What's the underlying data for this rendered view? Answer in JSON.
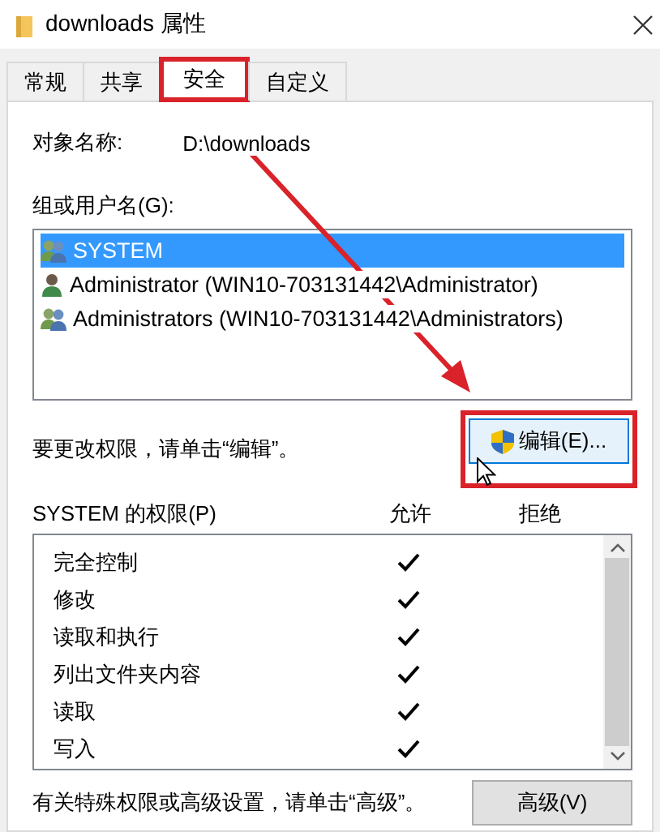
{
  "window": {
    "title": "downloads 属性"
  },
  "tabs": [
    {
      "label": "常规",
      "selected": false,
      "highlighted": false
    },
    {
      "label": "共享",
      "selected": false,
      "highlighted": false
    },
    {
      "label": "安全",
      "selected": true,
      "highlighted": true
    },
    {
      "label": "自定义",
      "selected": false,
      "highlighted": false
    }
  ],
  "object_name": {
    "label": "对象名称:",
    "value": "D:\\downloads"
  },
  "groups": {
    "label": "组或用户名(G):",
    "items": [
      {
        "name": "SYSTEM",
        "kind": "group",
        "selected": true
      },
      {
        "name": "Administrator (WIN10-703131442\\Administrator)",
        "kind": "user",
        "selected": false
      },
      {
        "name": "Administrators (WIN10-703131442\\Administrators)",
        "kind": "group",
        "selected": false
      }
    ]
  },
  "annotation_arrow": true,
  "edit_hint": "要更改权限，请单击“编辑”。",
  "edit_button": {
    "label": "编辑(E)...",
    "hovered": true,
    "highlighted": true
  },
  "permissions": {
    "title": "SYSTEM 的权限(P)",
    "columns": [
      "允许",
      "拒绝"
    ],
    "rows": [
      {
        "name": "完全控制",
        "allow": true,
        "deny": false
      },
      {
        "name": "修改",
        "allow": true,
        "deny": false
      },
      {
        "name": "读取和执行",
        "allow": true,
        "deny": false
      },
      {
        "name": "列出文件夹内容",
        "allow": true,
        "deny": false
      },
      {
        "name": "读取",
        "allow": true,
        "deny": false
      },
      {
        "name": "写入",
        "allow": true,
        "deny": false
      }
    ]
  },
  "advanced_hint": "有关特殊权限或高级设置，请单击“高级”。",
  "advanced_button": {
    "label": "高级(V)"
  }
}
